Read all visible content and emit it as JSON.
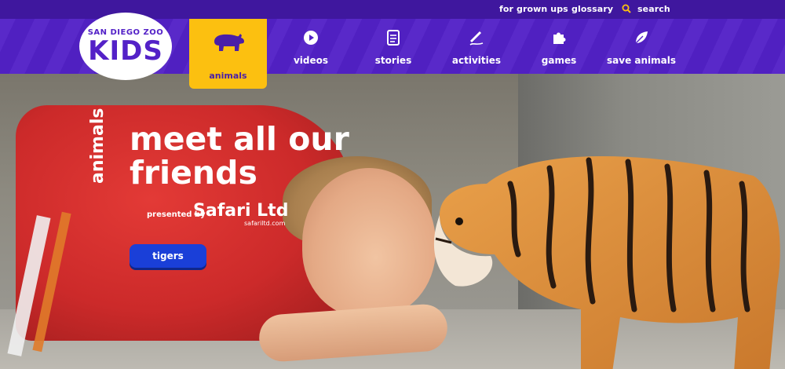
{
  "utility": {
    "links": [
      {
        "label": "for grown ups"
      },
      {
        "label": "glossary"
      },
      {
        "label": "search",
        "icon": "search-icon"
      }
    ]
  },
  "logo": {
    "top_text": "SAN DIEGO ZOO",
    "main_text": "KIDS"
  },
  "nav": {
    "items": [
      {
        "label": "animals",
        "icon": "bear-icon",
        "active": true
      },
      {
        "label": "videos",
        "icon": "play-icon",
        "active": false
      },
      {
        "label": "stories",
        "icon": "document-icon",
        "active": false
      },
      {
        "label": "activities",
        "icon": "pencil-icon",
        "active": false
      },
      {
        "label": "games",
        "icon": "puzzle-icon",
        "active": false
      },
      {
        "label": "save animals",
        "icon": "leaf-icon",
        "active": false
      }
    ]
  },
  "hero": {
    "side_label": "animals",
    "title": "meet all our friends",
    "presented_by": "presented by",
    "sponsor_name": "Safari Ltd",
    "sponsor_url": "safariltd.com",
    "button_label": "tigers"
  },
  "colors": {
    "brand_purple": "#5321c7",
    "active_yellow": "#fcc010",
    "button_blue": "#1a3fd8"
  }
}
